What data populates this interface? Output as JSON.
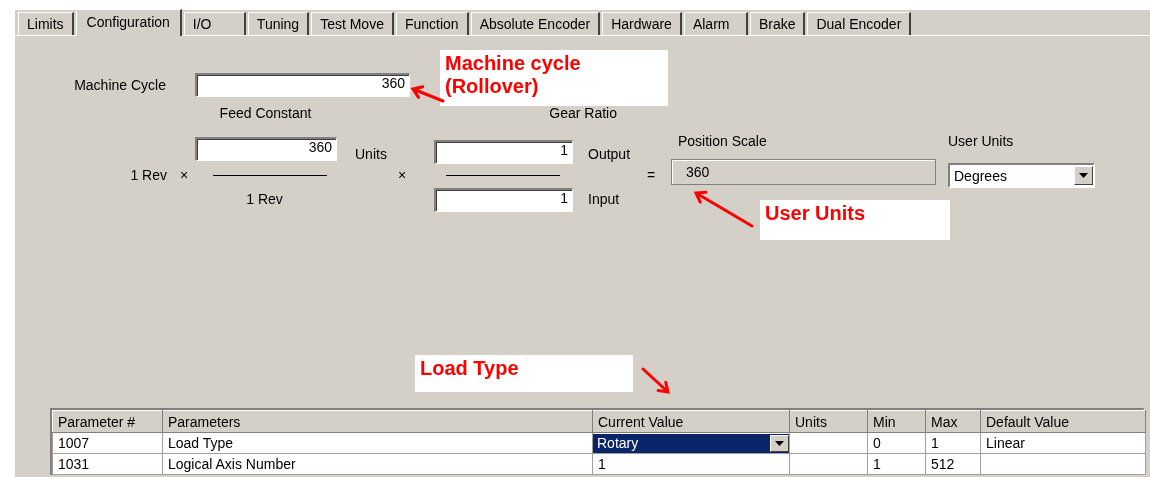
{
  "tabs": [
    {
      "label": "Limits",
      "selected": false
    },
    {
      "label": "Configuration",
      "selected": true
    },
    {
      "label": "I/O",
      "selected": false
    },
    {
      "label": "Tuning",
      "selected": false
    },
    {
      "label": "Test Move",
      "selected": false
    },
    {
      "label": "Function",
      "selected": false
    },
    {
      "label": "Absolute Encoder",
      "selected": false
    },
    {
      "label": "Hardware",
      "selected": false
    },
    {
      "label": "Alarm",
      "selected": false
    },
    {
      "label": "Brake",
      "selected": false
    },
    {
      "label": "Dual Encoder",
      "selected": false
    }
  ],
  "machine_cycle": {
    "label": "Machine Cycle",
    "value": "360"
  },
  "feed_constant": {
    "label": "Feed Constant",
    "value": "360",
    "units_label": "Units",
    "numerator_label": "1 Rev",
    "denominator_label": "1 Rev",
    "operator": "×"
  },
  "gear_ratio": {
    "label": "Gear Ratio",
    "operator": "×",
    "output": {
      "label": "Output",
      "value": "1"
    },
    "input": {
      "label": "Input",
      "value": "1"
    }
  },
  "position_scale": {
    "operator": "=",
    "label": "Position Scale",
    "value": "360"
  },
  "user_units": {
    "label": "User Units",
    "value": "Degrees"
  },
  "annotations": [
    {
      "lines": [
        "Machine cycle",
        "(Rollover)"
      ]
    },
    {
      "lines": [
        "User Units"
      ]
    },
    {
      "lines": [
        "Load Type"
      ]
    }
  ],
  "parameter_table": {
    "columns": [
      "Parameter #",
      "Parameters",
      "Current Value",
      "Units",
      "Min",
      "Max",
      "Default Value"
    ],
    "rows": [
      {
        "number": "1007",
        "name": "Load Type",
        "current_value": "Rotary",
        "editing": true,
        "min": "0",
        "max": "1",
        "default_value": "Linear"
      },
      {
        "number": "1031",
        "name": "Logical Axis Number",
        "current_value": "1",
        "editing": false,
        "min": "1",
        "max": "512"
      }
    ]
  }
}
